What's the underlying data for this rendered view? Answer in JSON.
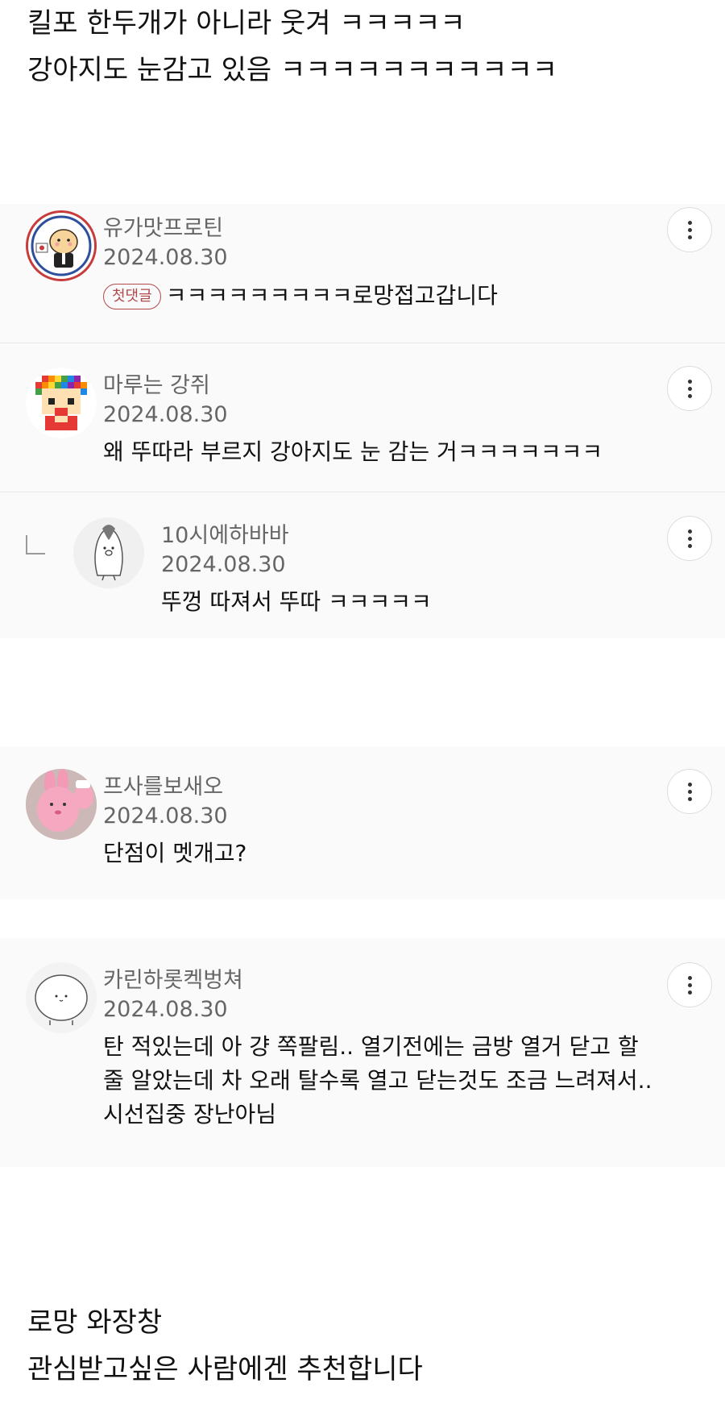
{
  "intro": {
    "line1": "킬포 한두개가 아니라 웃겨 ㅋㅋㅋㅋㅋ",
    "line2": "강아지도 눈감고 있음 ㅋㅋㅋㅋㅋㅋㅋㅋㅋㅋㅋ"
  },
  "comments": [
    {
      "author": "유가맛프로틴",
      "date": "2024.08.30",
      "badge": "첫댓글",
      "text_lines": [
        "ㅋㅋㅋㅋㅋㅋㅋㅋㅋ로망접고갑니다"
      ]
    },
    {
      "author": "마루는 강쥐",
      "date": "2024.08.30",
      "text_lines": [
        "왜 뚜따라 부르지 강아지도 눈 감는 거ㅋㅋㅋㅋㅋㅋㅋ"
      ]
    },
    {
      "author": "10시에하바바",
      "date": "2024.08.30",
      "text_lines": [
        "뚜껑 따져서 뚜따 ㅋㅋㅋㅋㅋ"
      ]
    },
    {
      "author": "프사를보새오",
      "date": "2024.08.30",
      "text_lines": [
        "단점이 멧개고?"
      ]
    },
    {
      "author": "카린하롯켁벙쳐",
      "date": "2024.08.30",
      "text_lines": [
        "탄 적있는데 아 걍 쪽팔림.. 열기전에는 금방 열거 닫고 할",
        "줄 알았는데 차 오래 탈수록 열고 닫는것도 조금 느려져서..",
        "시선집중 장난아님"
      ]
    }
  ],
  "outro": {
    "line1": "로망 와장창",
    "line2": "관심받고싶은 사람에겐 추천합니다"
  },
  "icons": {
    "more": "more-vertical-icon",
    "reply": "reply-arrow-icon"
  },
  "colors": {
    "badge": "#b14a4a",
    "meta_text": "#666666",
    "comment_bg": "#fafafa"
  }
}
